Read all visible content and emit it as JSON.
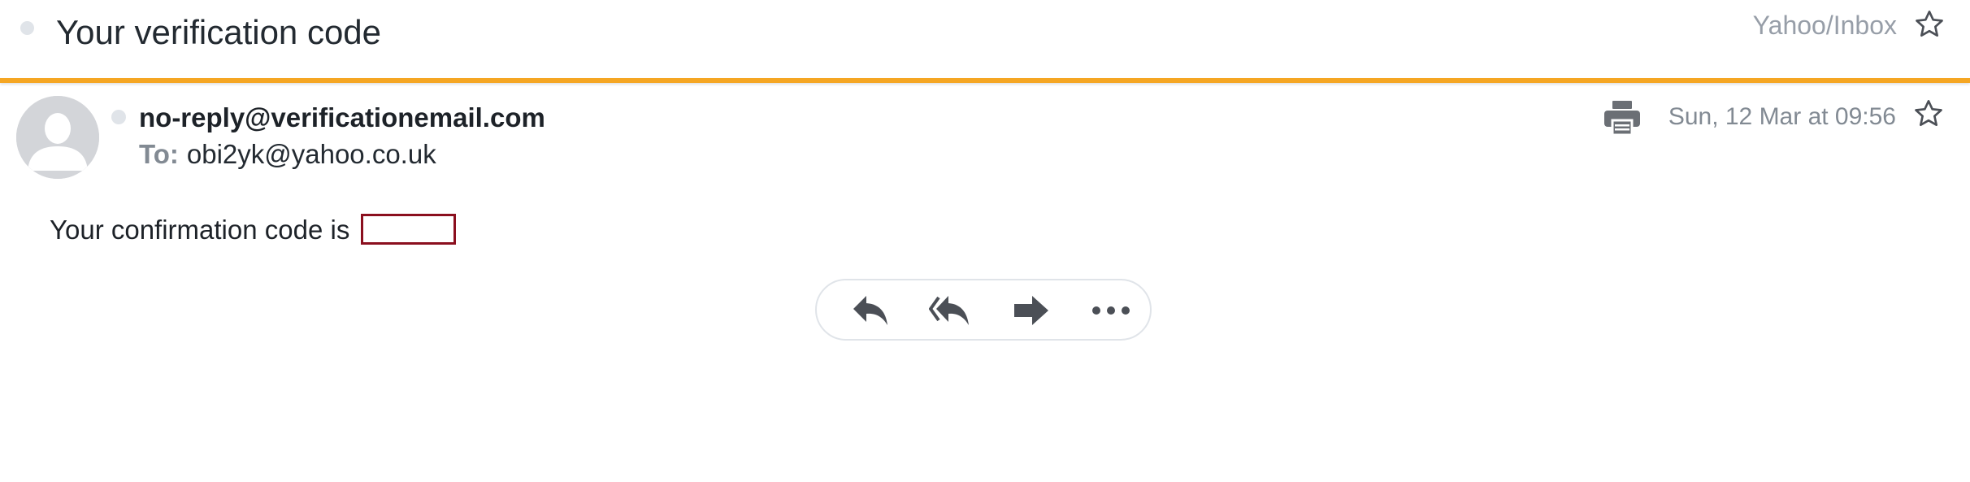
{
  "subject": {
    "title": "Your verification code",
    "folder": "Yahoo/Inbox",
    "icons": {
      "unread": "dot-icon",
      "star": "star-outline-icon"
    }
  },
  "colors": {
    "accent": "#f5a623",
    "code_box_border": "#8b0f1e",
    "icon_gray": "#4b4f56",
    "muted_text": "#828a93"
  },
  "message": {
    "sender": "no-reply@verificationemail.com",
    "to_label": "To:",
    "recipient": "obi2yk@yahoo.co.uk",
    "date": "Sun, 12 Mar at 09:56",
    "icons": {
      "avatar": "default-avatar-icon",
      "print": "printer-icon",
      "star": "star-outline-icon"
    }
  },
  "body": {
    "text": "Your confirmation code is",
    "code": ""
  },
  "actions": [
    {
      "name": "reply",
      "icon": "reply-icon"
    },
    {
      "name": "reply-all",
      "icon": "reply-all-icon"
    },
    {
      "name": "forward",
      "icon": "forward-icon"
    },
    {
      "name": "more",
      "icon": "more-dots-icon"
    }
  ]
}
